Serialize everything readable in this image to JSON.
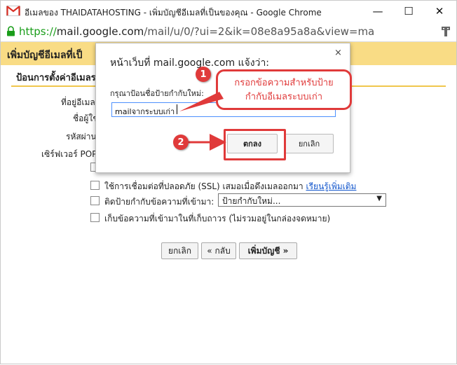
{
  "window": {
    "title": "อีเมลของ THAIDATAHOSTING - เพิ่มบัญชีอีเมลที่เป็นของคุณ - Google Chrome",
    "minimize_glyph": "—",
    "maximize_glyph": "☐",
    "close_glyph": "✕"
  },
  "address": {
    "scheme": "https://",
    "host": "mail.google.com",
    "path": "/mail/u/0/?ui=2&ik=08e8a95a8a&view=ma"
  },
  "page": {
    "heading": "เพิ่มบัญชีอีเมลที่เป็",
    "subheading": "ป้อนการตั้งค่าอีเมลร",
    "labels": {
      "email": "ที่อยู่อีเมล",
      "username": "ชื่อผู้ใช",
      "password": "รหัสผ่าน",
      "pop_server": "เซิร์ฟเวอร์ POP"
    },
    "checkboxes": {
      "ssl": "ใช้การเชื่อมต่อที่ปลอดภัย (SSL) เสมอเมื่อดึงเมลออกมา",
      "ssl_link": "เรียนรู้เพิ่มเติม",
      "label_incoming": "ติดป้ายกำกับข้อความที่เข้ามา:",
      "archive": "เก็บข้อความที่เข้ามาในที่เก็บถาวร (ไม่รวมอยู่ในกล่องจดหมาย)"
    },
    "label_select_value": "ป้ายกำกับใหม่...",
    "buttons": {
      "cancel": "ยกเลิก",
      "back": "« กลับ",
      "add_account": "เพิ่มบัญชี »"
    }
  },
  "dialog": {
    "title": "หน้าเว็บที่ mail.google.com แจ้งว่า:",
    "close_glyph": "×",
    "prompt": "กรุณาป้อนชื่อป้ายกำกับใหม่:",
    "input_value": "mailจากระบบเก่า",
    "ok_label": "ตกลง",
    "cancel_label": "ยกเลิก"
  },
  "annotations": {
    "badge1": "1",
    "badge2": "2",
    "callout_line1": "กรอกข้อความสำหรับป้าย",
    "callout_line2": "กำกับอีเมลระบบเก่า",
    "accent_color": "#e03a3a"
  }
}
